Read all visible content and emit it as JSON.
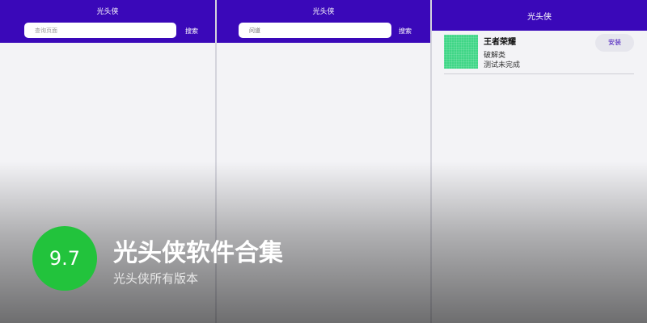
{
  "panels": [
    {
      "title": "光头侠",
      "search_placeholder": "查询页面",
      "search_button": "搜索"
    },
    {
      "title": "光头侠",
      "search_placeholder": "问道",
      "search_button": "搜索"
    },
    {
      "title": "光头侠",
      "app": {
        "name": "王者荣耀",
        "category": "破解类",
        "status": "测试未完成",
        "install_label": "安装",
        "icon": "app-thumbnail-icon"
      }
    }
  ],
  "overlay": {
    "score": "9.7",
    "title": "光头侠软件合集",
    "subtitle": "光头侠所有版本"
  },
  "colors": {
    "header": "#3a08b9",
    "score_badge": "#22c33c",
    "thumbnail": "#3fd686"
  }
}
